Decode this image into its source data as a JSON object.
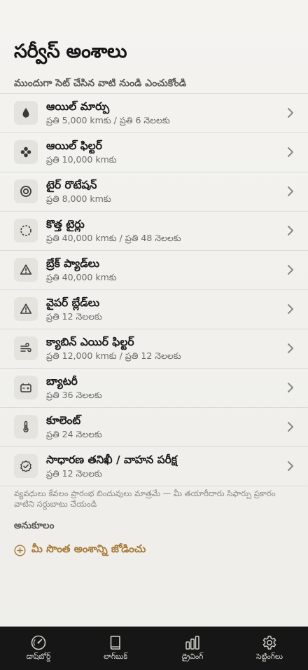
{
  "page": {
    "title": "సర్వీస్ అంశాలు",
    "section_header": "ముందుగా సెట్ చేసిన వాటి నుండి ఎంచుకోండి"
  },
  "items": [
    {
      "title": "ఆయిల్ మార్పు",
      "subtitle": "ప్రతి 5,000 kmకు / ప్రతి 6 నెలలకు",
      "icon": "oil-drop-icon"
    },
    {
      "title": "ఆయిల్ ఫిల్టర్",
      "subtitle": "ప్రతి 10,000 kmకు",
      "icon": "filter-dots-icon"
    },
    {
      "title": "టైర్ రొటేషన్",
      "subtitle": "ప్రతి 8,000 kmకు",
      "icon": "target-circle-icon"
    },
    {
      "title": "కొత్త టైర్లు",
      "subtitle": "ప్రతి 40,000 kmకు / ప్రతి 48 నెలలకు",
      "icon": "dashed-circle-icon"
    },
    {
      "title": "బ్రేక్ ప్యాడ్‌లు",
      "subtitle": "ప్రతి 40,000 kmకు",
      "icon": "warning-triangle-icon"
    },
    {
      "title": "వైపర్ బ్లేడ్‌లు",
      "subtitle": "ప్రతి 12 నెలలకు",
      "icon": "warning-triangle-icon"
    },
    {
      "title": "క్యాబిన్ ఎయిర్ ఫిల్టర్",
      "subtitle": "ప్రతి 12,000 kmకు / ప్రతి 12 నెలలకు",
      "icon": "wind-icon"
    },
    {
      "title": "బ్యాటరీ",
      "subtitle": "ప్రతి 36 నెలలకు",
      "icon": "battery-icon"
    },
    {
      "title": "కూలెంట్",
      "subtitle": "ప్రతి 24 నెలలకు",
      "icon": "thermometer-icon"
    },
    {
      "title": "సాధారణ తనిఖీ / వాహన పరీక్ష",
      "subtitle": "ప్రతి 12 నెలలకు",
      "icon": "check-badge-icon"
    }
  ],
  "footnote": "వ్యవధులు కేవలం ప్రారంభ బిందువులు మాత్రమే — మీ తయారీదారు సిఫార్సు ప్రకారం వాటిని సర్దుబాటు చేయండి",
  "custom": {
    "header": "అనుకూలం",
    "add_label": "మీ సొంత అంశాన్ని జోడించు"
  },
  "tabs": [
    {
      "label": "డాష్‌బోర్డ్",
      "icon": "speedometer-icon"
    },
    {
      "label": "లాగ్‌బుక్",
      "icon": "book-icon"
    },
    {
      "label": "డ్రైవింగ్",
      "icon": "bar-chart-icon"
    },
    {
      "label": "సెట్టింగ్‌లు",
      "icon": "gear-icon"
    }
  ],
  "colors": {
    "accent": "#a87a36",
    "background": "#f2f1ee",
    "tabbar": "#161616"
  }
}
